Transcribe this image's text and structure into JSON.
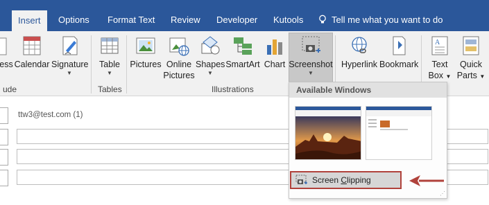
{
  "tabs": [
    {
      "label": "Insert",
      "active": true
    },
    {
      "label": "Options"
    },
    {
      "label": "Format Text"
    },
    {
      "label": "Review"
    },
    {
      "label": "Developer"
    },
    {
      "label": "Kutools"
    }
  ],
  "tell_me": "Tell me what you want to do",
  "ribbon": {
    "buttons": {
      "business_partial": "ess",
      "calendar": "Calendar",
      "signature": "Signature",
      "table": "Table",
      "pictures": "Pictures",
      "online_pictures_l1": "Online",
      "online_pictures_l2": "Pictures",
      "shapes": "Shapes",
      "smartart": "SmartArt",
      "chart": "Chart",
      "screenshot": "Screenshot",
      "hyperlink": "Hyperlink",
      "bookmark": "Bookmark",
      "textbox_l1": "Text",
      "textbox_l2": "Box",
      "quickparts_l1": "Quick",
      "quickparts_l2": "Parts"
    },
    "groups": {
      "include_partial": "ude",
      "tables": "Tables",
      "illustrations": "Illustrations"
    }
  },
  "mail": {
    "from_address": "ttw3@test.com (1)"
  },
  "dropdown": {
    "header": "Available Windows",
    "clip_prefix": "Screen ",
    "clip_underlined": "C",
    "clip_suffix": "lipping"
  },
  "colors": {
    "tab_bar": "#2b579a",
    "ribbon": "#f1f1f1",
    "highlight_border": "#b0423b"
  }
}
